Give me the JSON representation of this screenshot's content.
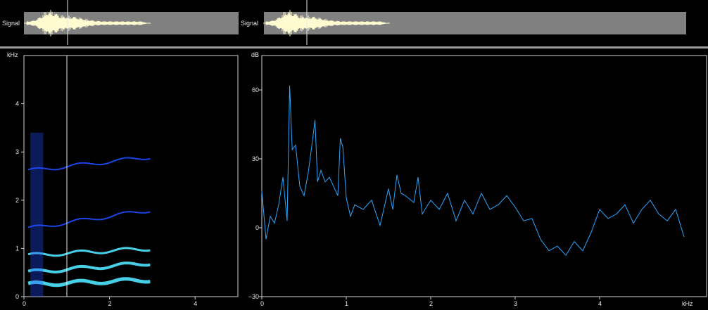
{
  "signal_label": "Signal",
  "spectrogram": {
    "y_unit": "kHz",
    "y_ticks": [
      "0",
      "1",
      "2",
      "3",
      "4"
    ],
    "x_ticks": [
      "0",
      "2",
      "4"
    ],
    "x_range": [
      0,
      5
    ],
    "y_range": [
      0,
      5
    ],
    "cursor_x": 1.0
  },
  "spectrum": {
    "y_unit": "dB",
    "x_unit": "kHz",
    "y_ticks": [
      "60",
      "30",
      "0",
      "−30"
    ],
    "x_ticks": [
      "0",
      "1",
      "2",
      "3",
      "4"
    ],
    "x_range": [
      0,
      5
    ],
    "y_range": [
      -30,
      75
    ]
  },
  "colors": {
    "waveform": "#fffbd0",
    "spectrum_line": "#2aa7ff",
    "spectrogram_hot": "#4fe6ff",
    "spectrogram_cool": "#1f4dff",
    "track": "#808080"
  },
  "chart_data": {
    "type": "line",
    "title": "",
    "xlabel": "kHz",
    "ylabel": "dB",
    "xlim": [
      0,
      5
    ],
    "ylim": [
      -30,
      70
    ],
    "series": [
      {
        "x": [
          0.0,
          0.05,
          0.1,
          0.15,
          0.2,
          0.25,
          0.3,
          0.33,
          0.36,
          0.4,
          0.45,
          0.5,
          0.55,
          0.6,
          0.63,
          0.66,
          0.7,
          0.75,
          0.8,
          0.85,
          0.9,
          0.93,
          0.96,
          1.0,
          1.05,
          1.1,
          1.2,
          1.3,
          1.4,
          1.5,
          1.55,
          1.6,
          1.65,
          1.7,
          1.8,
          1.85,
          1.9,
          2.0,
          2.1,
          2.2,
          2.3,
          2.4,
          2.5,
          2.6,
          2.7,
          2.8,
          2.9,
          3.0,
          3.1,
          3.2,
          3.3,
          3.4,
          3.5,
          3.6,
          3.7,
          3.8,
          3.9,
          4.0,
          4.1,
          4.2,
          4.3,
          4.4,
          4.5,
          4.6,
          4.7,
          4.8,
          4.9,
          5.0
        ],
        "y": [
          16,
          -5,
          5,
          2,
          10,
          22,
          3,
          62,
          34,
          36,
          18,
          14,
          24,
          38,
          47,
          20,
          25,
          20,
          22,
          18,
          14,
          39,
          35,
          13,
          5,
          10,
          8,
          12,
          1,
          17,
          8,
          23,
          15,
          14,
          11,
          22,
          6,
          12,
          8,
          15,
          3,
          12,
          6,
          15,
          8,
          10,
          14,
          9,
          3,
          4,
          -5,
          -10,
          -8,
          -12,
          -6,
          -10,
          -2,
          8,
          4,
          6,
          10,
          2,
          8,
          12,
          6,
          3,
          8,
          -4
        ]
      }
    ]
  }
}
